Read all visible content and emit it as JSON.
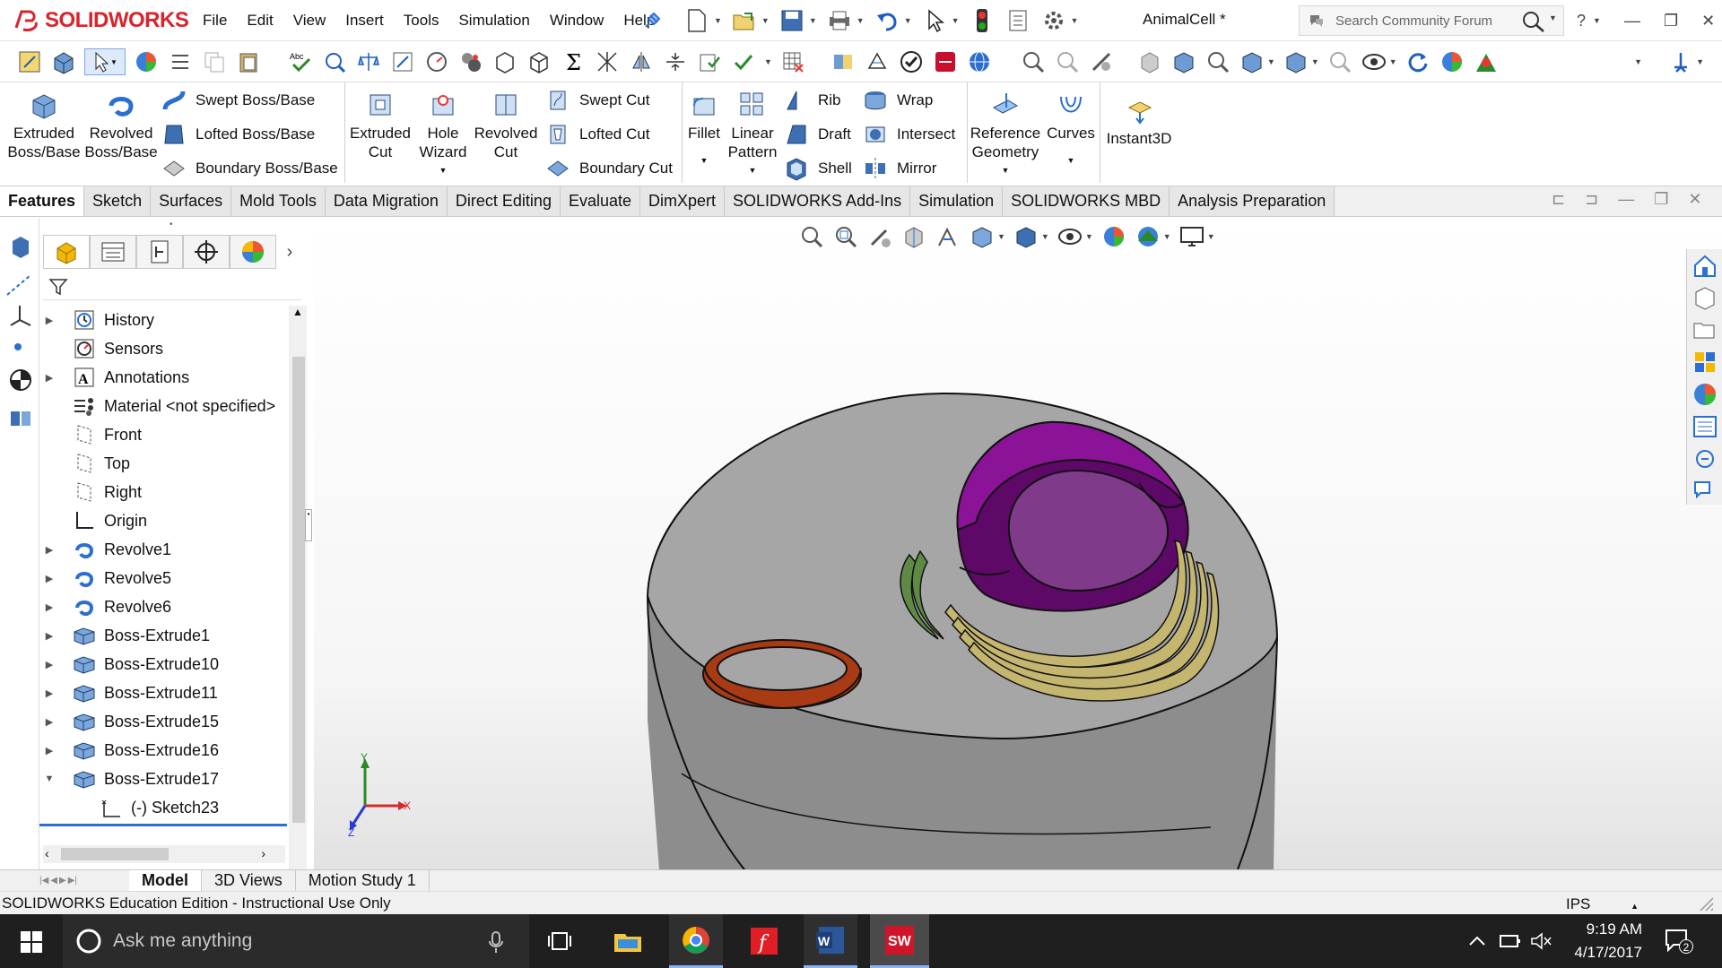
{
  "app": {
    "brand": "SOLIDWORKS",
    "document_title": "AnimalCell *"
  },
  "menu": [
    "File",
    "Edit",
    "View",
    "Insert",
    "Tools",
    "Simulation",
    "Window",
    "Help"
  ],
  "search": {
    "placeholder": "Search Community Forum"
  },
  "features": {
    "extruded_boss": "Extruded Boss/Base",
    "revolved_boss": "Revolved Boss/Base",
    "swept_boss": "Swept Boss/Base",
    "lofted_boss": "Lofted Boss/Base",
    "boundary_boss": "Boundary Boss/Base",
    "extruded_cut": "Extruded Cut",
    "hole_wizard": "Hole Wizard",
    "revolved_cut": "Revolved Cut",
    "swept_cut": "Swept Cut",
    "lofted_cut": "Lofted Cut",
    "boundary_cut": "Boundary Cut",
    "fillet": "Fillet",
    "linear_pattern": "Linear Pattern",
    "rib": "Rib",
    "draft": "Draft",
    "shell": "Shell",
    "wrap": "Wrap",
    "intersect": "Intersect",
    "mirror": "Mirror",
    "reference_geometry": "Reference Geometry",
    "curves": "Curves",
    "instant3d": "Instant3D"
  },
  "tabs": [
    "Features",
    "Sketch",
    "Surfaces",
    "Mold Tools",
    "Data Migration",
    "Direct Editing",
    "Evaluate",
    "DimXpert",
    "SOLIDWORKS Add-Ins",
    "Simulation",
    "SOLIDWORKS MBD",
    "Analysis Preparation"
  ],
  "tree": [
    {
      "label": "History",
      "icon": "history-icon",
      "expandable": true
    },
    {
      "label": "Sensors",
      "icon": "sensors-icon",
      "expandable": false
    },
    {
      "label": "Annotations",
      "icon": "annotations-icon",
      "expandable": true
    },
    {
      "label": "Material <not specified>",
      "icon": "material-icon",
      "expandable": false
    },
    {
      "label": "Front",
      "icon": "plane-icon",
      "expandable": false
    },
    {
      "label": "Top",
      "icon": "plane-icon",
      "expandable": false
    },
    {
      "label": "Right",
      "icon": "plane-icon",
      "expandable": false
    },
    {
      "label": "Origin",
      "icon": "origin-icon",
      "expandable": false
    },
    {
      "label": "Revolve1",
      "icon": "revolve-icon",
      "expandable": true
    },
    {
      "label": "Revolve5",
      "icon": "revolve-icon",
      "expandable": true
    },
    {
      "label": "Revolve6",
      "icon": "revolve-icon",
      "expandable": true
    },
    {
      "label": "Boss-Extrude1",
      "icon": "extrude-icon",
      "expandable": true
    },
    {
      "label": "Boss-Extrude10",
      "icon": "extrude-icon",
      "expandable": true
    },
    {
      "label": "Boss-Extrude11",
      "icon": "extrude-icon",
      "expandable": true
    },
    {
      "label": "Boss-Extrude15",
      "icon": "extrude-icon",
      "expandable": true
    },
    {
      "label": "Boss-Extrude16",
      "icon": "extrude-icon",
      "expandable": true
    },
    {
      "label": "Boss-Extrude17",
      "icon": "extrude-icon",
      "expandable": true,
      "expanded": true
    },
    {
      "label": "(-) Sketch23",
      "icon": "sketch-icon",
      "expandable": false,
      "child": true
    }
  ],
  "bottom_tabs": [
    "Model",
    "3D Views",
    "Motion Study 1"
  ],
  "status": {
    "text": "SOLIDWORKS Education Edition - Instructional Use Only",
    "units": "IPS"
  },
  "triad": {
    "x": "X",
    "y": "Y",
    "z": "Z"
  },
  "taskbar": {
    "search_placeholder": "Ask me anything",
    "time": "9:19 AM",
    "date": "4/17/2017",
    "notifications": "2"
  },
  "colors": {
    "body": "#9a9a9a",
    "nucleus": "#7a0a86",
    "nucleolus": "#8b3a8f",
    "er": "#c4b56f",
    "mitochondria": "#5f8a46",
    "lysosome": "#b23c17"
  }
}
